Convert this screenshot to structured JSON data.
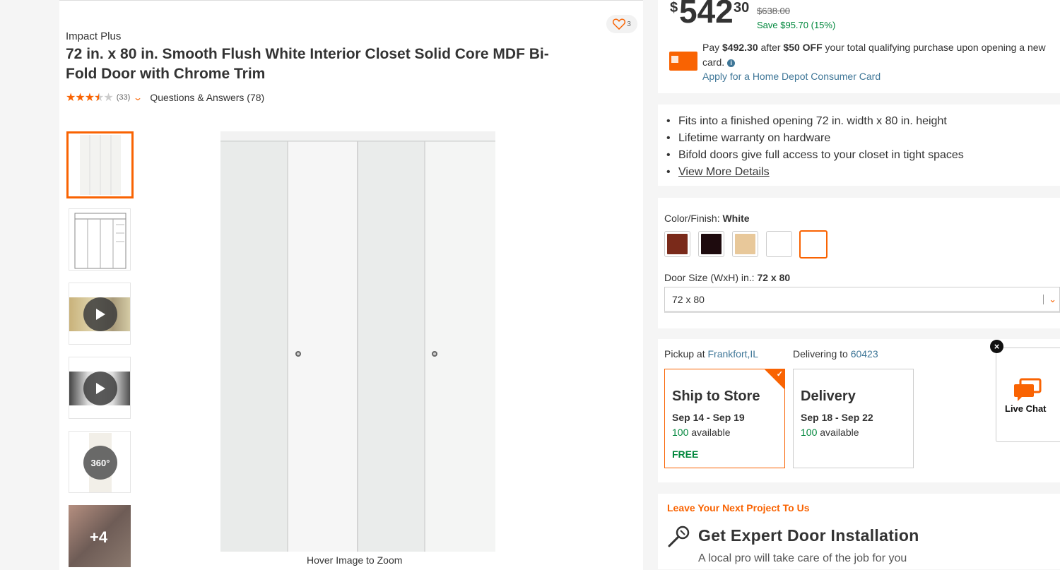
{
  "product": {
    "brand": "Impact Plus",
    "title": "72 in. x 80 in. Smooth Flush White Interior Closet Solid Core MDF Bi-Fold Door with Chrome Trim",
    "rating": 3.5,
    "review_count": "(33)",
    "qa_label": "Questions & Answers (78)",
    "favorites_count": "3"
  },
  "gallery": {
    "thumbs": [
      "door",
      "diagram",
      "video",
      "video",
      "360",
      "more"
    ],
    "badge_360": "360°",
    "more_label": "+4",
    "hover_text": "Hover Image to Zoom"
  },
  "price": {
    "dollar_sign": "$",
    "dollars": "542",
    "cents": "30",
    "was": "$638.00",
    "save": "Save $95.70 (15%)",
    "pay_prefix": "Pay ",
    "pay_amount": "$492.30",
    "pay_mid": " after ",
    "pay_off": "$50 OFF",
    "pay_suffix": " your total qualifying purchase upon opening a new card.",
    "apply_link": "Apply for a Home Depot Consumer Card"
  },
  "highlights": {
    "items": [
      "Fits into a finished opening 72 in. width x 80 in. height",
      "Lifetime warranty on hardware",
      "Bifold doors give full access to your closet in tight spaces"
    ],
    "view_more": "View More Details"
  },
  "options": {
    "color_label": "Color/Finish: ",
    "color_value": "White",
    "swatch_colors": [
      "#7a2a1a",
      "#1e0b0e",
      "#e8c89a",
      "#ffffff",
      "#ffffff"
    ],
    "size_label": "Door Size (WxH) in.: ",
    "size_value": "72 x 80",
    "size_selected": "72 x 80"
  },
  "fulfillment": {
    "pickup_prefix": "Pickup at ",
    "pickup_store": "Frankfort,IL",
    "deliver_prefix": "Delivering to ",
    "deliver_zip": "60423",
    "ship": {
      "title": "Ship to Store",
      "dates": "Sep 14 - Sep 19",
      "count": "100",
      "avail": " available",
      "price": "FREE"
    },
    "delivery": {
      "title": "Delivery",
      "dates": "Sep 18 - Sep 22",
      "count": "100",
      "avail": " available"
    }
  },
  "install": {
    "eyebrow": "Leave Your Next Project To Us",
    "heading": "Get Expert Door Installation",
    "sub": "A local pro will take care of the job for you"
  },
  "chat": {
    "label": "Live Chat"
  },
  "colors": {
    "accent": "#f96302",
    "link": "#3e7697",
    "green": "#00873c"
  }
}
